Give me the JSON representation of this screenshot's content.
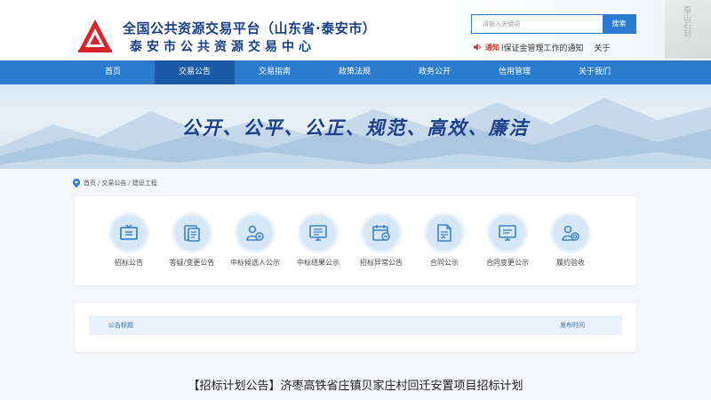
{
  "header": {
    "title_line1": "全国公共资源交易平台（山东省·泰安市）",
    "title_line2": "泰安市公共资源交易中心",
    "logo": "triangle-logo",
    "search": {
      "placeholder": "请输入关键词",
      "button_label": "搜索"
    },
    "notice": {
      "label": "通知",
      "text": "l保证金管理工作的通知",
      "text2": "关于"
    },
    "decoration": "泰山石刻"
  },
  "nav": {
    "items": [
      {
        "label": "首页"
      },
      {
        "label": "交易公告",
        "active": true
      },
      {
        "label": "交易指南"
      },
      {
        "label": "政策法规"
      },
      {
        "label": "政务公开"
      },
      {
        "label": "信用管理"
      },
      {
        "label": "关于我们"
      }
    ]
  },
  "banner": {
    "slogan": "公开、公平、公正、规范、高效、廉洁"
  },
  "breadcrumb": {
    "items": [
      "首页",
      "交易公告",
      "建设工程"
    ]
  },
  "categories": [
    {
      "label": "招标公告",
      "icon": "tv-icon"
    },
    {
      "label": "答疑/变更公告",
      "icon": "documents-icon"
    },
    {
      "label": "中标候选人公示",
      "icon": "person-badge-icon"
    },
    {
      "label": "中标结果公示",
      "icon": "monitor-list-icon"
    },
    {
      "label": "招标异常公告",
      "icon": "calendar-minus-icon"
    },
    {
      "label": "合同公示",
      "icon": "contract-icon"
    },
    {
      "label": "合同变更公示",
      "icon": "monitor-edit-icon"
    },
    {
      "label": "履约验收",
      "icon": "person-check-icon"
    }
  ],
  "list": {
    "col_title": "公告标题",
    "col_date": "发布时间"
  },
  "bottom_title": "【招标计划公告】济枣高铁省庄镇贝家庄村回迁安置项目招标计划",
  "colors": {
    "nav": "#2b7ccc",
    "nav_active": "#1a5aa6",
    "brand": "#1b3f86",
    "icon_bg": "#d6e8f7",
    "alert": "#d6342c"
  }
}
